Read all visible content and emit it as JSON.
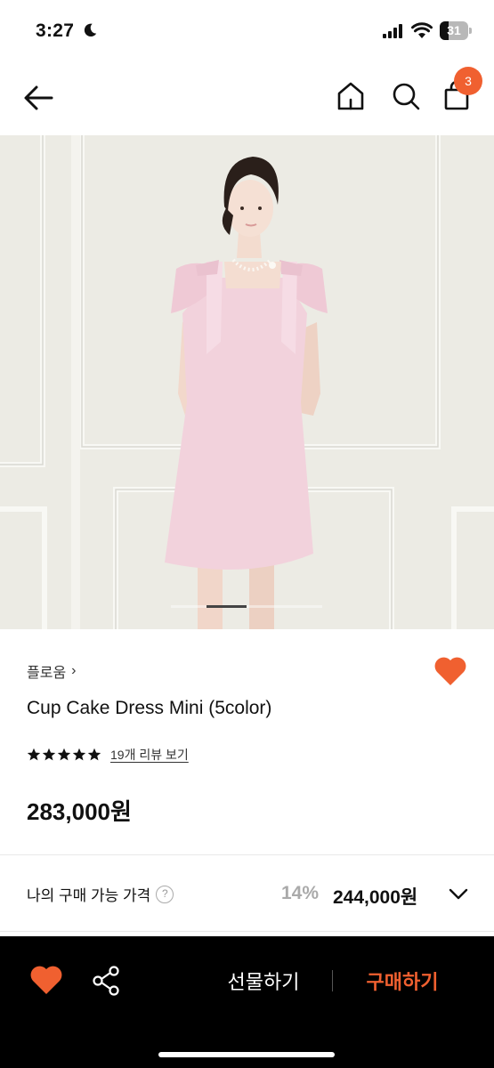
{
  "status_bar": {
    "time": "3:27",
    "battery_level": "31",
    "battery_fraction": 0.31
  },
  "header": {
    "cart_count": "3",
    "icons": [
      "back-arrow-icon",
      "home-icon",
      "search-icon",
      "shopping-bag-icon"
    ]
  },
  "gallery": {
    "image_subject": "Woman in a short pink square-neck dress with bow straps and a pearl necklace against a white paneled wall",
    "image_count": 4,
    "current_index": 1
  },
  "product": {
    "brand": "플로움",
    "brand_chevron": "›",
    "title": "Cup Cake Dress Mini (5color)",
    "rating_stars": 5,
    "review_link": "19개 리뷰 보기",
    "price": "283,000원",
    "wished": true
  },
  "my_price": {
    "label": "나의 구매 가능 가격",
    "help": "?",
    "discount_rate": "14%",
    "discount_price": "244,000원"
  },
  "bottom_bar": {
    "gift_label": "선물하기",
    "buy_label": "구매하기"
  },
  "colors": {
    "accent": "#f06030",
    "heart": "#f06030",
    "bottom_bar_bg": "#000000",
    "text": "#111111",
    "muted": "#aaaaaa"
  }
}
